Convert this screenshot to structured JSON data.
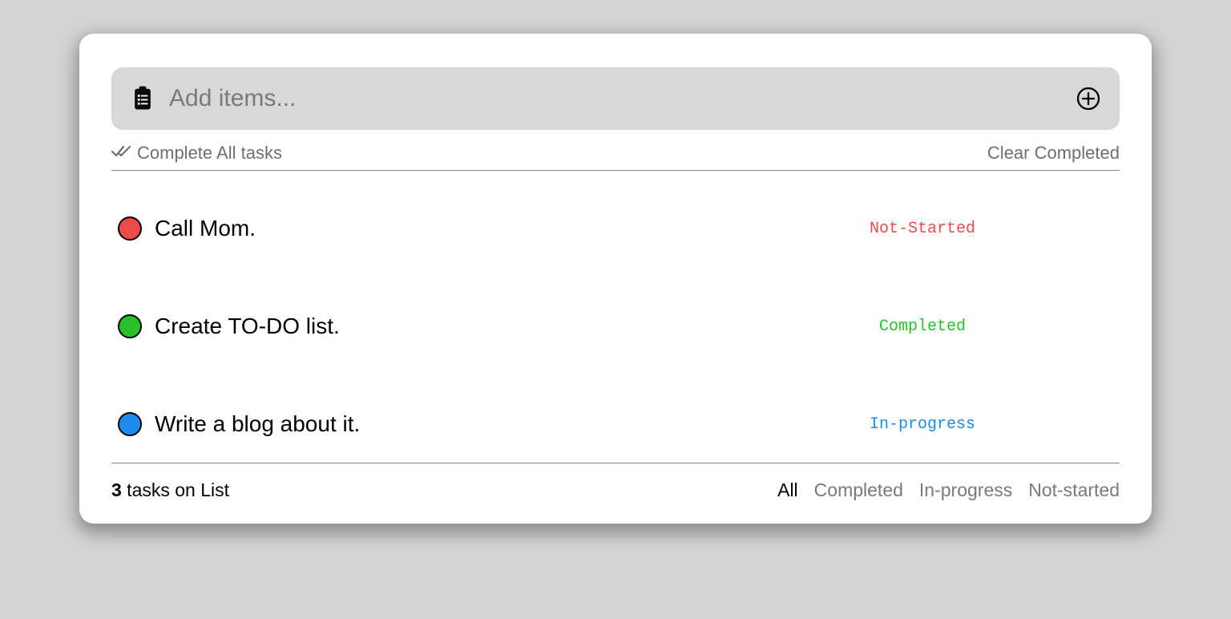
{
  "input": {
    "placeholder": "Add items...",
    "value": ""
  },
  "actions": {
    "complete_all_label": "Complete All tasks",
    "clear_completed_label": "Clear Completed"
  },
  "tasks": [
    {
      "title": "Call Mom.",
      "status": "Not-Started",
      "status_key": "red"
    },
    {
      "title": "Create TO-DO list.",
      "status": "Completed",
      "status_key": "green"
    },
    {
      "title": "Write a blog about it.",
      "status": "In-progress",
      "status_key": "blue"
    }
  ],
  "footer": {
    "count": "3",
    "count_suffix": " tasks on List",
    "filters": [
      {
        "label": "All",
        "active": true
      },
      {
        "label": "Completed",
        "active": false
      },
      {
        "label": "In-progress",
        "active": false
      },
      {
        "label": "Not-started",
        "active": false
      }
    ]
  },
  "colors": {
    "red": "#ef4a4a",
    "green": "#28c128",
    "blue": "#1d8cf0"
  }
}
